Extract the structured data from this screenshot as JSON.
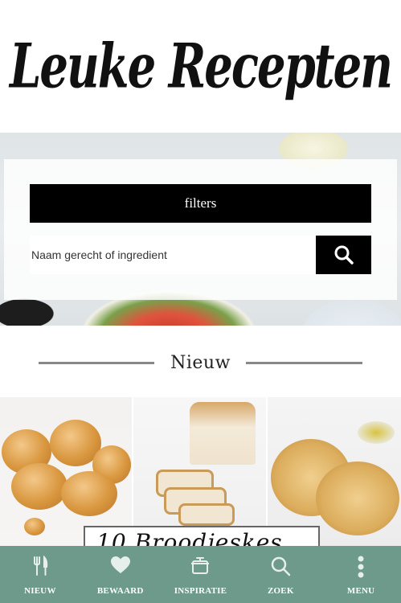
{
  "header": {
    "logo_text": "Leuke Recepten"
  },
  "hero": {
    "filters_label": "filters",
    "search_placeholder": "Naam gerecht of ingredient"
  },
  "section": {
    "title": "Nieuw"
  },
  "feature": {
    "banner_text": "10 Broodjeskes"
  },
  "tabbar": {
    "items": [
      {
        "label": "NIEUW",
        "icon": "cutlery-icon"
      },
      {
        "label": "BEWAARD",
        "icon": "heart-icon"
      },
      {
        "label": "INSPIRATIE",
        "icon": "pot-icon"
      },
      {
        "label": "ZOEK",
        "icon": "search-icon"
      },
      {
        "label": "MENU",
        "icon": "more-vertical-icon"
      }
    ]
  },
  "colors": {
    "tabbar_bg": "#6d9a8a",
    "button_bg": "#000000"
  }
}
